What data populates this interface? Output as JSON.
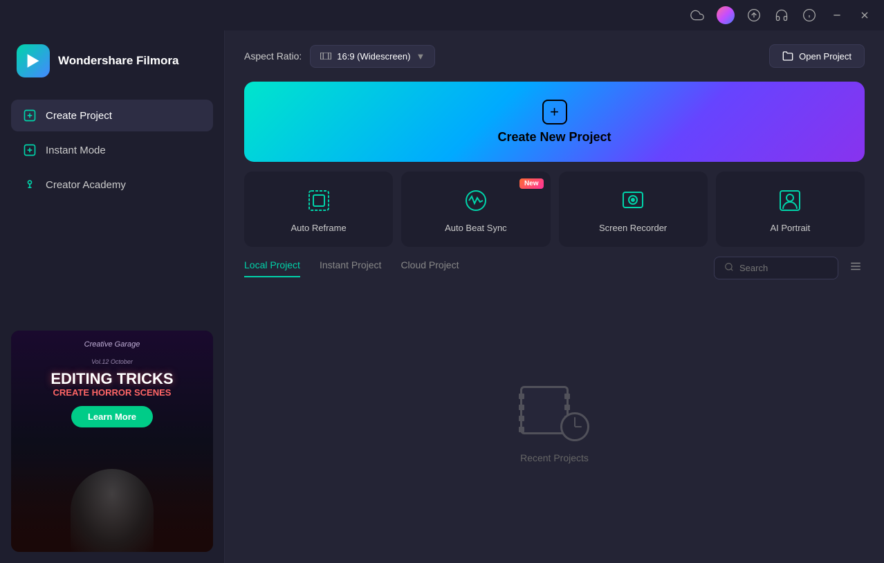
{
  "titleBar": {
    "icons": [
      "cloud-icon",
      "avatar-icon",
      "upload-icon",
      "headphones-icon",
      "info-icon",
      "minimize-icon",
      "close-icon"
    ]
  },
  "sidebar": {
    "logo": {
      "name": "Wondershare Filmora"
    },
    "nav": [
      {
        "id": "create-project",
        "label": "Create Project",
        "active": true
      },
      {
        "id": "instant-mode",
        "label": "Instant Mode",
        "active": false
      },
      {
        "id": "creator-academy",
        "label": "Creator Academy",
        "active": false
      }
    ],
    "banner": {
      "subtitle1": "Creative Garage",
      "subtitle2": "Vol.12 October",
      "mainText": "EDITING TRICKS",
      "subText": "CREATE HORROR SCENES",
      "btnLabel": "Learn More"
    }
  },
  "topBar": {
    "aspectLabel": "Aspect Ratio:",
    "aspectValue": "16:9 (Widescreen)",
    "openProjectLabel": "Open Project"
  },
  "createBanner": {
    "label": "Create New Project"
  },
  "featureCards": [
    {
      "id": "auto-reframe",
      "label": "Auto Reframe",
      "isNew": false
    },
    {
      "id": "auto-beat-sync",
      "label": "Auto Beat Sync",
      "isNew": true
    },
    {
      "id": "screen-recorder",
      "label": "Screen Recorder",
      "isNew": false
    },
    {
      "id": "ai-portrait",
      "label": "AI Portrait",
      "isNew": false
    }
  ],
  "projectTabs": [
    {
      "id": "local-project",
      "label": "Local Project",
      "active": true
    },
    {
      "id": "instant-project",
      "label": "Instant Project",
      "active": false
    },
    {
      "id": "cloud-project",
      "label": "Cloud Project",
      "active": false
    }
  ],
  "search": {
    "placeholder": "Search"
  },
  "emptyState": {
    "text": "Recent Projects"
  },
  "badges": {
    "new": "New"
  }
}
